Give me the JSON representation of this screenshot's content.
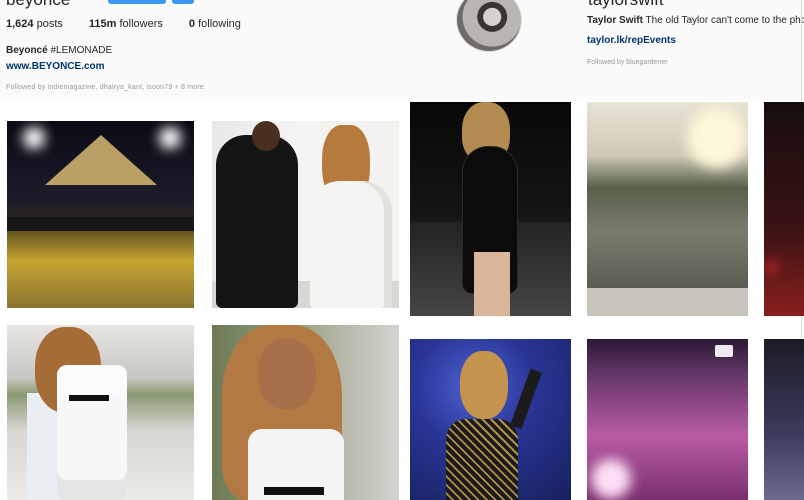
{
  "left_profile": {
    "username": "beyonce",
    "stats": {
      "posts_count": "1,624",
      "posts_label": "posts",
      "followers_count": "115m",
      "followers_label": "followers",
      "following_count": "0",
      "following_label": "following"
    },
    "bio_name": "Beyoncé",
    "bio_tag": "#LEMONADE",
    "website": "www.BEYONCE.com",
    "followed_by": "Followed by indiemagazine, dhairya_kant, isoon79 + 8 more"
  },
  "right_profile": {
    "username": "taylorswift",
    "bio_name": "Taylor Swift",
    "bio_text": "The old Taylor can't come to the phone ri",
    "website": "taylor.lk/repEvents",
    "followed_by": "Followed by bluegardener"
  },
  "grid": {
    "photos": [
      {
        "name": "Beyonce stage performance photo"
      },
      {
        "name": "Beyonce and Jay-Z walking photo"
      },
      {
        "name": "Taylor Swift concert photo"
      },
      {
        "name": "Stadium crowd photo"
      },
      {
        "name": "Partial concert photo"
      },
      {
        "name": "Beyonce white outfit photo"
      },
      {
        "name": "Beyonce closeup photo"
      },
      {
        "name": "Taylor Swift blue stage photo"
      },
      {
        "name": "Pink stadium photo"
      },
      {
        "name": "Partial crowd photo"
      }
    ]
  },
  "colors": {
    "link": "#003569",
    "follow_button": "#3897f0",
    "muted_text": "#999999"
  }
}
